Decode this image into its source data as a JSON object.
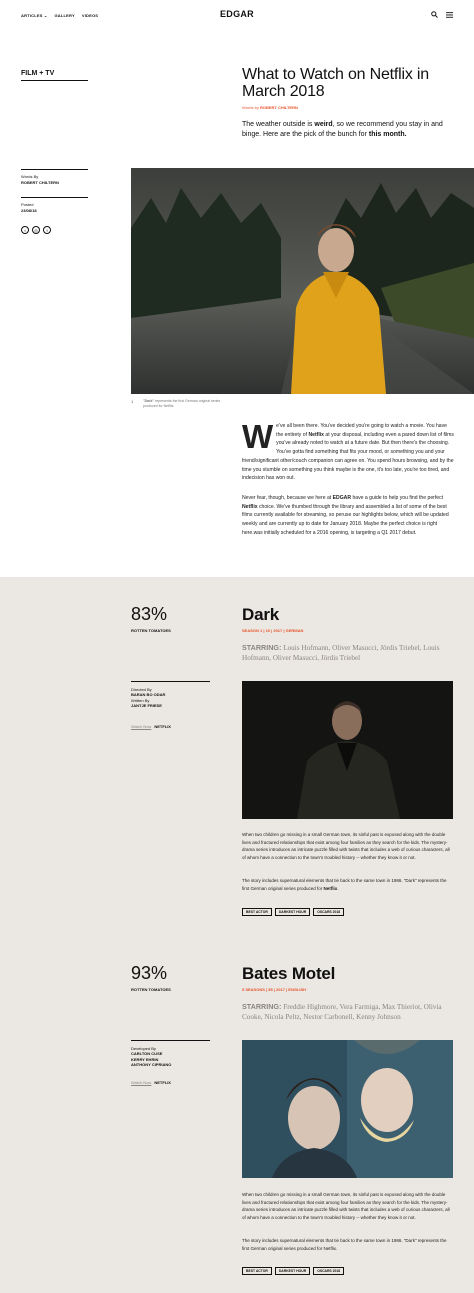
{
  "header": {
    "nav": [
      "ARTICLES",
      "GALLERY",
      "VIDEOS"
    ],
    "logo": "EDGAR"
  },
  "article": {
    "section": "FILM + TV",
    "title": "What to Watch on Netflix in March 2018",
    "byline_prefix": "Words by",
    "author": "ROBERT CHILTERN",
    "lede_1": "The weather outside is ",
    "lede_bold_1": "weird",
    "lede_2": ", so we recommend you stay in and binge. Here are the pick of the bunch for ",
    "lede_bold_2": "this month.",
    "words_by_label": "Words By",
    "words_by": "ROBERT CHILTERN",
    "posted_label": "Posted",
    "posted": "23/08/18",
    "caption_num": "1",
    "caption_bold": "\"Dark\"",
    "caption": " represents the first German original series produced for Netflix.",
    "dropcap": "W",
    "p1_a": "e've all been there. You've decided you're going to watch a movie. You have the entirety of ",
    "p1_b": "Netflix",
    "p1_c": " at your disposal, including even a pared down list of films you've already noted to watch at a future date. But then there's the choosing. You've gotta find something that fits your mood, or something you and your friend/significant other/couch companion can agree on. You spend hours browsing, and by the time you stumble on something you think maybe is the one, it's too late, you're too tired, and indecision has won out.",
    "p2_a": "Never fear, though, because we here at ",
    "p2_b": "EDGAR",
    "p2_c": " have a guide to help you find the perfect ",
    "p2_d": "Netflix",
    "p2_e": " choice. We've thumbed through the library and assembled a list of some of the best films currently available for streaming, so peruse our highlights below, which will be updated weekly and are currently up to date for January 2018. Maybe the perfect choice is right here.was initially scheduled for a 2016 opening, is targeting a Q1 2017 debut."
  },
  "shows": [
    {
      "score": "83%",
      "score_label": "ROTTEN TOMATOES",
      "title": "Dark",
      "meta": "SEASON 1  |  10  |  2017  |  GERMAN",
      "starring_label": "STARRING:",
      "starring": " Louis Hofmann, Oliver Masucci, Jördis Triebel, Louis Hofmann, Oliver Masucci, Jördis Triebel",
      "credit1_label": "Directed By",
      "credit1": "BARAN BO ODAR",
      "credit2_label": "Written By",
      "credit2": "JANTJE FRIESE",
      "watch_label": "Watch Now",
      "platform": "NETFLIX",
      "desc1": "When two children go missing in a small German town, its sinful past is exposed along with the double lives and fractured relationships that exist among four families as they search for the kids. The mystery-drama series introduces an intricate puzzle filled with twists that includes a web of curious characters, all of whom have a connection to the town's troubled history -- whether they know it or not.",
      "desc2_a": "The story includes supernatural elements that tie back to the same town in 1986. \"Dark\" represents the first German original series produced for ",
      "desc2_b": "Netflix",
      "desc2_c": ".",
      "tags": [
        "BEST ACTOR",
        "DARKEST HOUR",
        "OSCARS 2018"
      ]
    },
    {
      "score": "93%",
      "score_label": "ROTTEN TOMATOES",
      "title": "Bates Motel",
      "meta": "5 SEASONS  |  55  |  2017  |  ENGLISH",
      "starring_label": "STARRING:",
      "starring": " Freddie Highmore, Vera Farmiga, Max Thieriot, Olivia Cooke, Nicola Peltz, Nestor Carbonell, Kenny Johnson",
      "credit1_label": "Developed By",
      "credit1": "CARLTON CUSE",
      "credit2": "KERRY EHRIN",
      "credit3": "ANTHONY CIPRIANO",
      "watch_label": "Watch Now",
      "platform": "NETFLIX",
      "desc1": "When two children go missing in a small German town, its sinful past is exposed along with the double lives and fractured relationships that exist among four families as they search for the kids. The mystery-drama series introduces an intricate puzzle filled with twists that includes a web of curious characters, all of whom have a connection to the town's troubled history -- whether they know it or not.",
      "desc2": "The story includes supernatural elements that tie back to the same town in 1986. \"Dark\" represents the first German original series produced for Netflix.",
      "tags": [
        "BEST ACTOR",
        "DARKEST HOUR",
        "OSCARS 2018"
      ]
    }
  ]
}
